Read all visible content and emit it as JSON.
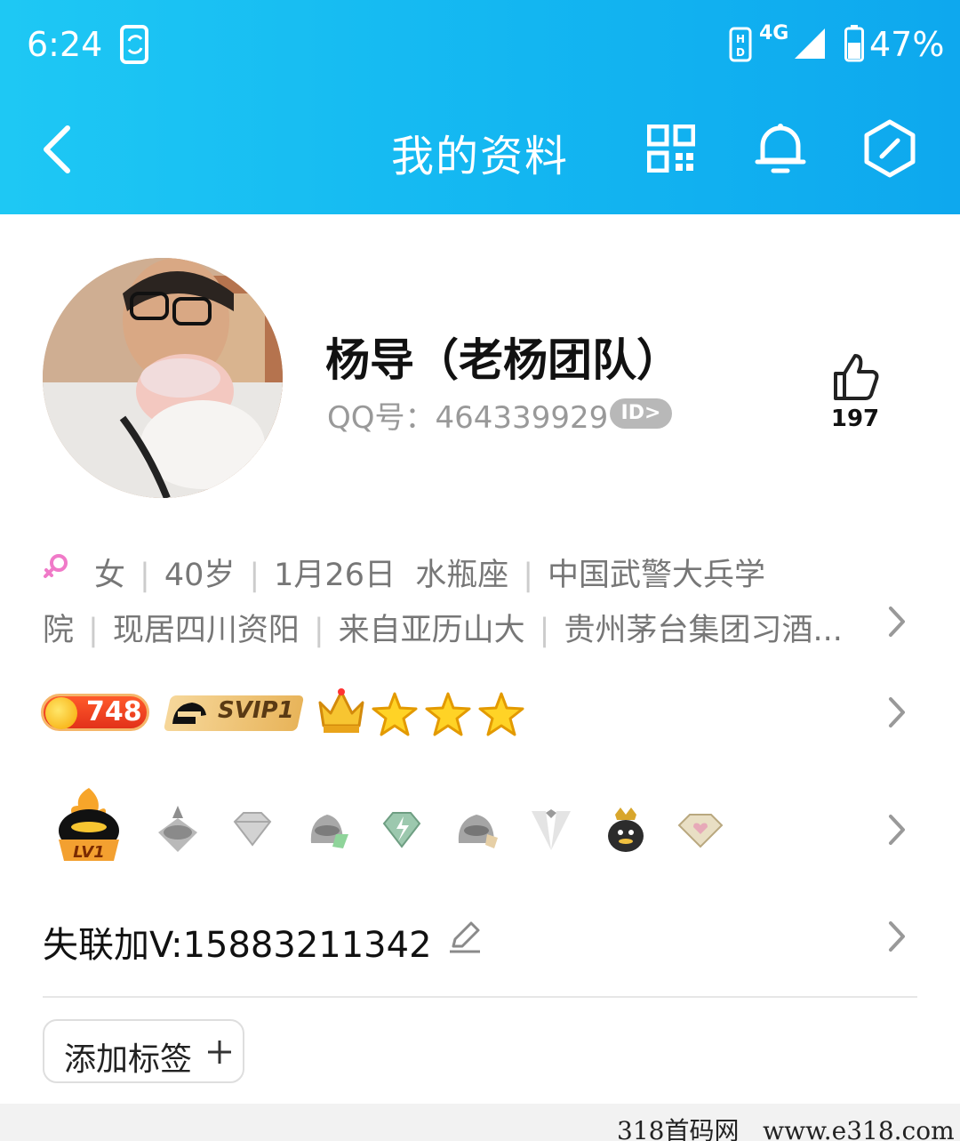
{
  "status_bar": {
    "time": "6:24",
    "network": "4G",
    "battery_pct": "47%",
    "icons": [
      "sync-phone-icon",
      "hd-icon",
      "signal-icon",
      "battery-icon"
    ]
  },
  "nav": {
    "title": "我的资料",
    "icons": [
      "back-icon",
      "qr-code-icon",
      "bell-icon",
      "hexagon-edit-icon"
    ]
  },
  "profile": {
    "name": "杨导（老杨团队）",
    "qq_label": "QQ号：",
    "qq_number": "464339929",
    "id_badge": "ID>",
    "likes": "197"
  },
  "info": {
    "line1": [
      "女",
      "40岁",
      "1月26日  水瓶座",
      "中国武警大兵学"
    ],
    "line2": [
      "院",
      "现居四川资阳",
      "来自亚历山大",
      "贵州茅台集团习酒..."
    ]
  },
  "badges": {
    "coin_value": "748",
    "svip_label": "SVIP1",
    "stars": 3
  },
  "contact": {
    "text": "失联加V:15883211342"
  },
  "tag_button": {
    "label": "添加标签"
  },
  "watermark": {
    "text": "318首码网   www.e318.com"
  },
  "colors": {
    "header_gradient_start": "#1ec8f4",
    "header_gradient_end": "#0ea8ee",
    "female_pink": "#f07ac8",
    "coin_red": "#e2311a"
  }
}
